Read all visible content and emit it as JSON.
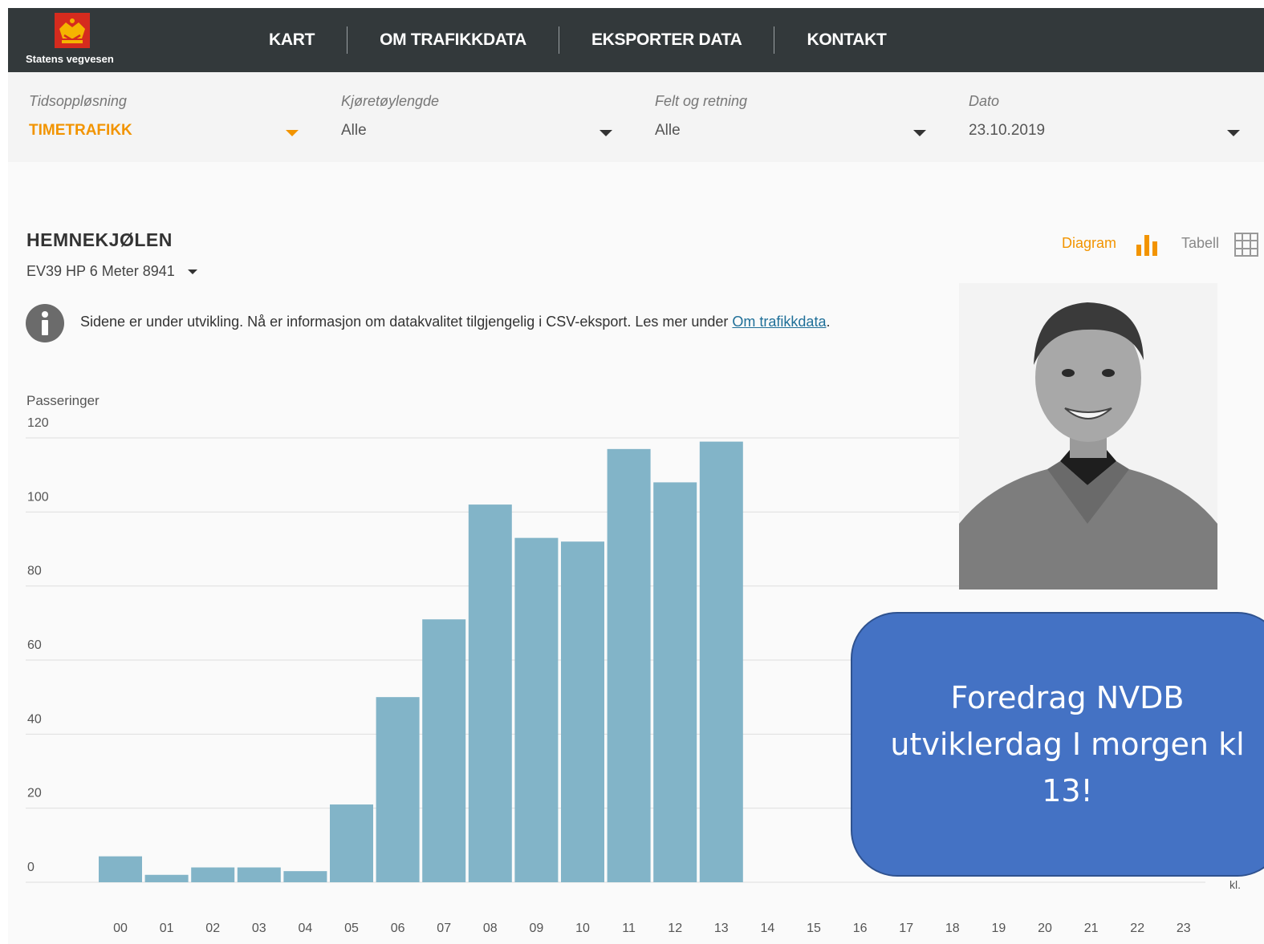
{
  "brand": {
    "org_name": "Statens vegvesen",
    "badge_color": "#d52b1e",
    "crown_color": "#f5b400"
  },
  "nav": {
    "items": [
      "KART",
      "OM TRAFIKKDATA",
      "EKSPORTER DATA",
      "KONTAKT"
    ]
  },
  "filters": [
    {
      "label": "Tidsoppløsning",
      "value": "TIMETRAFIKK"
    },
    {
      "label": "Kjøretøylengde",
      "value": "Alle"
    },
    {
      "label": "Felt og retning",
      "value": "Alle"
    },
    {
      "label": "Dato",
      "value": "23.10.2019"
    }
  ],
  "station": {
    "title": "HEMNEKJØLEN",
    "subtitle": "EV39 HP 6 Meter 8941"
  },
  "view_toggle": {
    "diagram_label": "Diagram",
    "table_label": "Tabell",
    "active": "Diagram",
    "active_color": "#f29400"
  },
  "info": {
    "icon": "info-icon",
    "text": "Sidene er under utvikling. Nå er informasjon om datakvalitet tilgjengelig i CSV-eksport. Les mer under ",
    "link_text": "Om trafikkdata",
    "suffix": "."
  },
  "chart_data": {
    "type": "bar",
    "ylabel": "Passeringer",
    "xlabel": "kl.",
    "ylim": [
      0,
      120
    ],
    "yticks": [
      0,
      20,
      40,
      60,
      80,
      100,
      120
    ],
    "grid": true,
    "bar_color": "#82b4c8",
    "categories": [
      "00",
      "01",
      "02",
      "03",
      "04",
      "05",
      "06",
      "07",
      "08",
      "09",
      "10",
      "11",
      "12",
      "13",
      "14",
      "15",
      "16",
      "17",
      "18",
      "19",
      "20",
      "21",
      "22",
      "23"
    ],
    "values": [
      7,
      2,
      4,
      4,
      3,
      21,
      50,
      71,
      102,
      93,
      92,
      117,
      108,
      119,
      null,
      null,
      null,
      null,
      null,
      null,
      null,
      null,
      null,
      null
    ]
  },
  "callout": {
    "text": "Foredrag NVDB utviklerdag I morgen kl 13!",
    "color": "#4472c4"
  }
}
